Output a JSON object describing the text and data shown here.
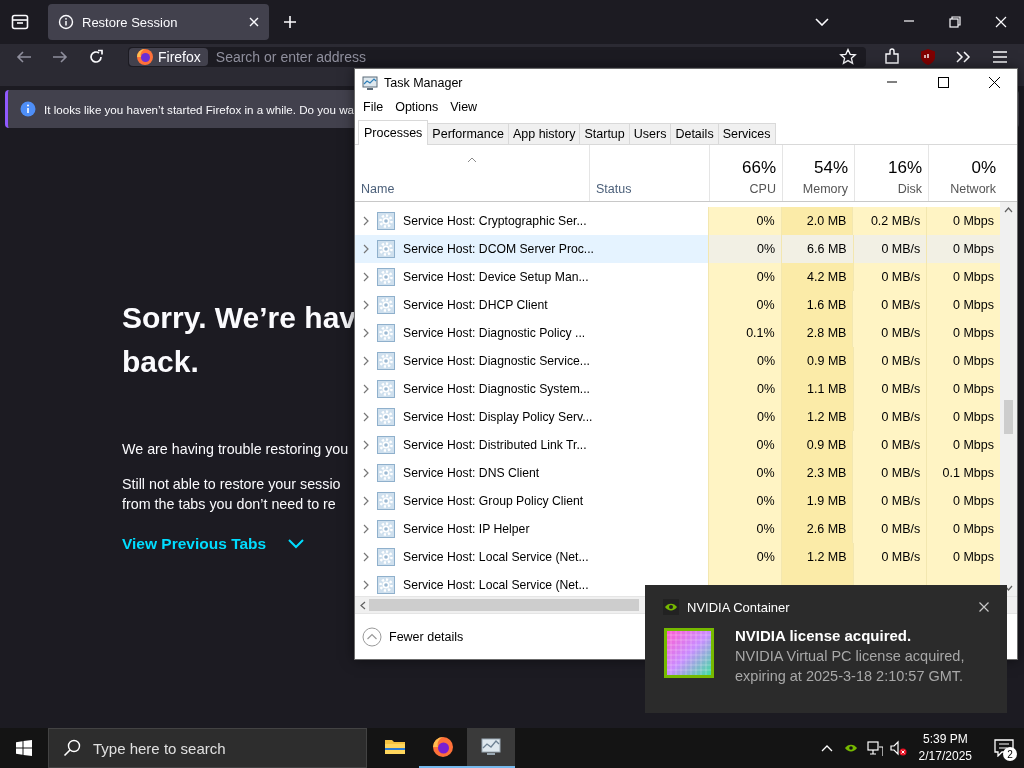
{
  "firefox": {
    "tabs": [
      {
        "title": "Restore Session",
        "selected": true
      }
    ],
    "url_bar": {
      "identity": "Firefox",
      "placeholder": "Search or enter address"
    },
    "notification_bar": {
      "message": "It looks like you haven’t started Firefox in a while. Do you wa"
    },
    "page": {
      "heading_lines": [
        "Sorry. We’re hav",
        "back."
      ],
      "paragraphs": [
        [
          "We are having trouble restoring you"
        ],
        [
          "Still not able to restore your sessio",
          "from the tabs you don’t need to re"
        ]
      ],
      "link": "View Previous Tabs"
    }
  },
  "task_manager": {
    "title": "Task Manager",
    "menu": [
      "File",
      "Options",
      "View"
    ],
    "tabs": [
      {
        "label": "Processes",
        "selected": true
      },
      {
        "label": "Performance",
        "selected": false
      },
      {
        "label": "App history",
        "selected": false
      },
      {
        "label": "Startup",
        "selected": false
      },
      {
        "label": "Users",
        "selected": false
      },
      {
        "label": "Details",
        "selected": false
      },
      {
        "label": "Services",
        "selected": false
      }
    ],
    "columns": [
      {
        "kind": "text",
        "label": "Name",
        "sorted": true
      },
      {
        "kind": "text",
        "label": "Status",
        "sorted": false
      },
      {
        "kind": "usage",
        "percent": "66%",
        "label": "CPU",
        "sorted": false
      },
      {
        "kind": "usage",
        "percent": "54%",
        "label": "Memory",
        "sorted": false
      },
      {
        "kind": "usage",
        "percent": "16%",
        "label": "Disk",
        "sorted": false
      },
      {
        "kind": "usage",
        "percent": "0%",
        "label": "Network",
        "sorted": false
      }
    ],
    "rows": [
      {
        "name": "Service Host: Cryptographic Ser...",
        "selected": false,
        "cpu": "0%",
        "memory": "2.0 MB",
        "disk": "0.2 MB/s",
        "network": "0 Mbps"
      },
      {
        "name": "Service Host: DCOM Server Proc...",
        "selected": true,
        "cpu": "0%",
        "memory": "6.6 MB",
        "disk": "0 MB/s",
        "network": "0 Mbps"
      },
      {
        "name": "Service Host: Device Setup Man...",
        "selected": false,
        "cpu": "0%",
        "memory": "4.2 MB",
        "disk": "0 MB/s",
        "network": "0 Mbps"
      },
      {
        "name": "Service Host: DHCP Client",
        "selected": false,
        "cpu": "0%",
        "memory": "1.6 MB",
        "disk": "0 MB/s",
        "network": "0 Mbps"
      },
      {
        "name": "Service Host: Diagnostic Policy ...",
        "selected": false,
        "cpu": "0.1%",
        "memory": "2.8 MB",
        "disk": "0 MB/s",
        "network": "0 Mbps"
      },
      {
        "name": "Service Host: Diagnostic Service...",
        "selected": false,
        "cpu": "0%",
        "memory": "0.9 MB",
        "disk": "0 MB/s",
        "network": "0 Mbps"
      },
      {
        "name": "Service Host: Diagnostic System...",
        "selected": false,
        "cpu": "0%",
        "memory": "1.1 MB",
        "disk": "0 MB/s",
        "network": "0 Mbps"
      },
      {
        "name": "Service Host: Display Policy Serv...",
        "selected": false,
        "cpu": "0%",
        "memory": "1.2 MB",
        "disk": "0 MB/s",
        "network": "0 Mbps"
      },
      {
        "name": "Service Host: Distributed Link Tr...",
        "selected": false,
        "cpu": "0%",
        "memory": "0.9 MB",
        "disk": "0 MB/s",
        "network": "0 Mbps"
      },
      {
        "name": "Service Host: DNS Client",
        "selected": false,
        "cpu": "0%",
        "memory": "2.3 MB",
        "disk": "0 MB/s",
        "network": "0.1 Mbps"
      },
      {
        "name": "Service Host: Group Policy Client",
        "selected": false,
        "cpu": "0%",
        "memory": "1.9 MB",
        "disk": "0 MB/s",
        "network": "0 Mbps"
      },
      {
        "name": "Service Host: IP Helper",
        "selected": false,
        "cpu": "0%",
        "memory": "2.6 MB",
        "disk": "0 MB/s",
        "network": "0 Mbps"
      },
      {
        "name": "Service Host: Local Service (Net...",
        "selected": false,
        "cpu": "0%",
        "memory": "1.2 MB",
        "disk": "0 MB/s",
        "network": "0 Mbps"
      },
      {
        "name": "Service Host: Local Service (Net...",
        "selected": false
      }
    ],
    "footer": "Fewer details"
  },
  "notification": {
    "app": "NVIDIA Container",
    "title": "NVIDIA license acquired.",
    "body_lines": [
      "NVIDIA Virtual PC license acquired,",
      "expiring at 2025-3-18 2:10:57 GMT."
    ]
  },
  "taskbar": {
    "search_placeholder": "Type here to search",
    "apps": [
      {
        "kind": "explorer",
        "running": false,
        "selected": false
      },
      {
        "kind": "firefox",
        "running": true,
        "selected": false
      },
      {
        "kind": "task-manager",
        "running": true,
        "selected": true
      }
    ],
    "time": "5:39 PM",
    "date": "2/17/2025",
    "notification_count": "2"
  }
}
